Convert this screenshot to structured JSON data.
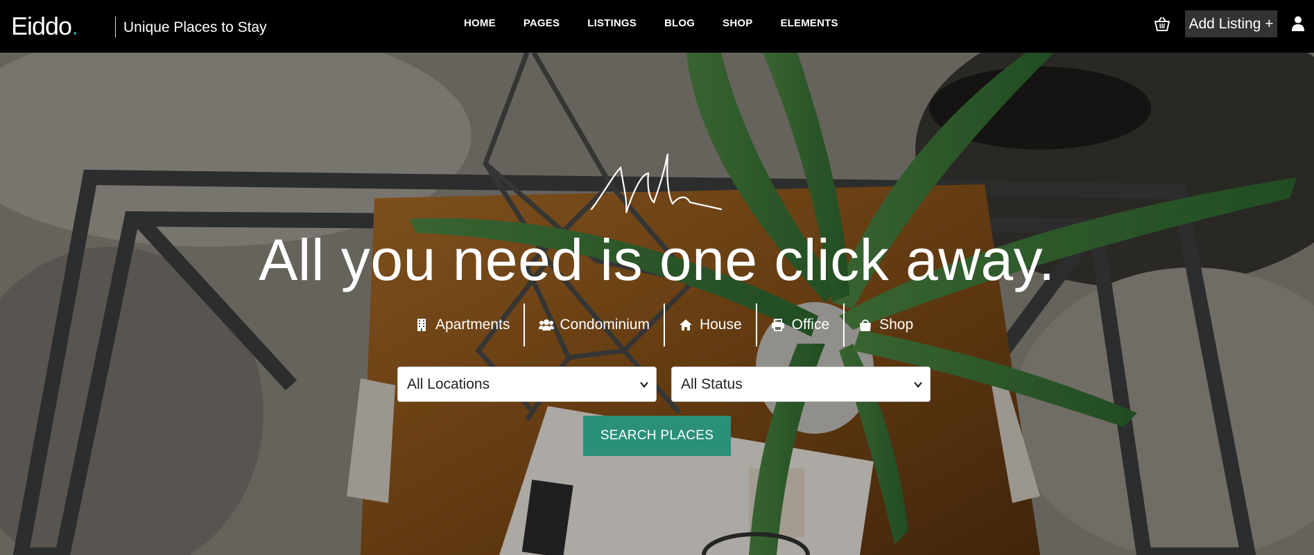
{
  "header": {
    "logo_text": "Eiddo",
    "logo_dot": ".",
    "tagline": "Unique Places to Stay",
    "nav": [
      "HOME",
      "PAGES",
      "LISTINGS",
      "BLOG",
      "SHOP",
      "ELEMENTS"
    ],
    "add_listing_label": "Add Listing +",
    "icons": {
      "cart": "basket-icon",
      "user": "user-icon"
    }
  },
  "hero": {
    "headline": "All you need is one click away.",
    "categories": [
      {
        "label": "Apartments",
        "icon": "building-icon"
      },
      {
        "label": "Condominium",
        "icon": "users-icon"
      },
      {
        "label": "House",
        "icon": "home-icon"
      },
      {
        "label": "Office",
        "icon": "printer-icon"
      },
      {
        "label": "Shop",
        "icon": "shopping-bag-icon"
      }
    ],
    "location_select": {
      "value": "All Locations"
    },
    "status_select": {
      "value": "All Status"
    },
    "search_label": "SEARCH PLACES"
  },
  "colors": {
    "accent": "#2a9078",
    "logo_dot": "#2a9d8f",
    "topbar": "#000000",
    "add_listing_bg": "#333333"
  }
}
